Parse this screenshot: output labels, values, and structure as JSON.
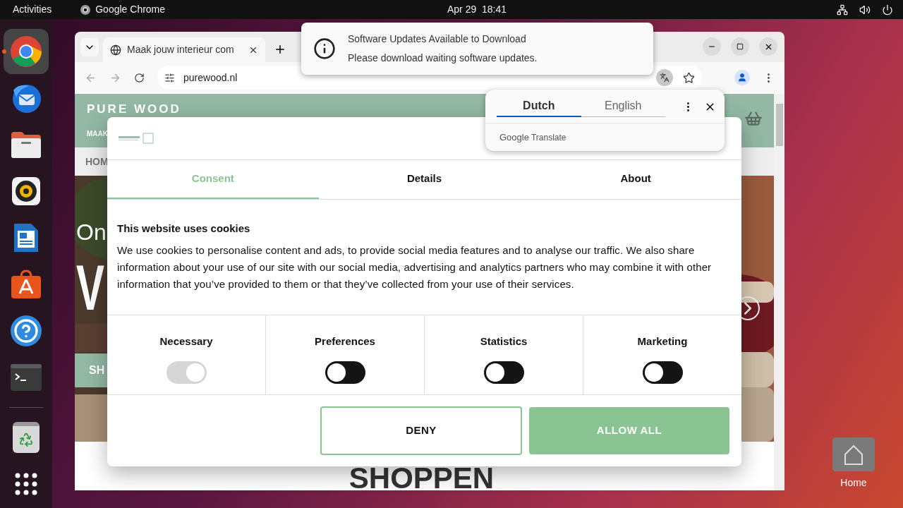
{
  "top_bar": {
    "activities": "Activities",
    "app": "Google Chrome",
    "clock": "Apr 29  18:41"
  },
  "dock": [
    {
      "kind": "chrome",
      "running": true
    },
    {
      "kind": "mail",
      "running": false
    },
    {
      "kind": "files",
      "running": false
    },
    {
      "kind": "music",
      "running": false
    },
    {
      "kind": "writer",
      "running": false
    },
    {
      "kind": "store",
      "running": false
    },
    {
      "kind": "help",
      "running": false
    },
    {
      "kind": "terminal",
      "running": false
    },
    {
      "kind": "separator"
    },
    {
      "kind": "trash",
      "running": false
    },
    {
      "kind": "grid",
      "running": false
    }
  ],
  "desktop": {
    "home_label": "Home"
  },
  "browser": {
    "tab_title": "Maak jouw interieur com",
    "url": "purewood.nl"
  },
  "notification": {
    "title": "Software Updates Available to Download",
    "body": "Please download waiting software updates."
  },
  "translate": {
    "languages": [
      {
        "label": "Dutch",
        "selected": true
      },
      {
        "label": "English",
        "selected": false
      }
    ],
    "brand": "Google",
    "product": "Translate"
  },
  "page": {
    "logo": "PURE WOOD",
    "tagline": "MAAK",
    "nav": "HOM",
    "hero_line": "On",
    "hero_big": "V",
    "hero_button": "SH",
    "section_heading": "SHOPPEN"
  },
  "cookie_dialog": {
    "tabs": [
      {
        "label": "Consent",
        "selected": true
      },
      {
        "label": "Details",
        "selected": false
      },
      {
        "label": "About",
        "selected": false
      }
    ],
    "title": "This website uses cookies",
    "text": "We use cookies to personalise content and ads, to provide social media features and to analyse our traffic. We also share information about your use of our site with our social media, advertising and analytics partners who may combine it with other information that you’ve provided to them or that they’ve collected from your use of their services.",
    "categories": [
      {
        "label": "Necessary",
        "checked": true,
        "disabled": true
      },
      {
        "label": "Preferences",
        "checked": false,
        "disabled": false
      },
      {
        "label": "Statistics",
        "checked": false,
        "disabled": false
      },
      {
        "label": "Marketing",
        "checked": false,
        "disabled": false
      }
    ],
    "buttons": [
      {
        "label": "DENY",
        "kind": "outline"
      },
      {
        "label": "ALLOW ALL",
        "kind": "filled"
      }
    ]
  }
}
